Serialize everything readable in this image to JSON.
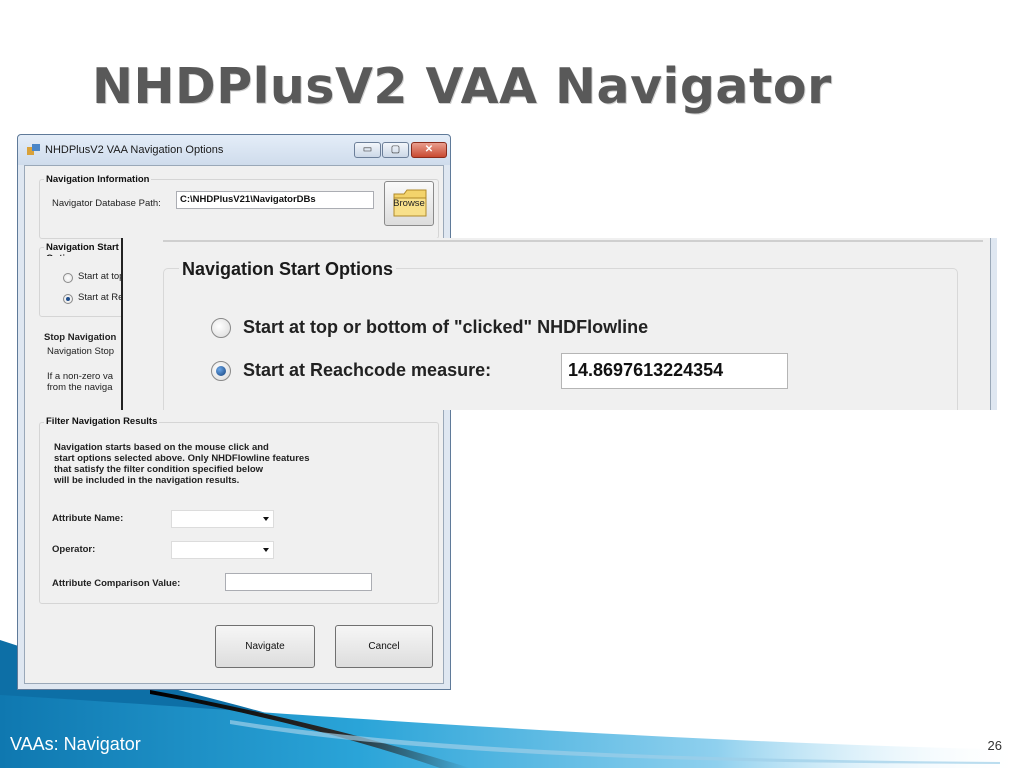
{
  "slide": {
    "title": "NHDPlusV2 VAA Navigator",
    "footer": "VAAs: Navigator",
    "page_number": "26"
  },
  "dialog": {
    "title": "NHDPlusV2 VAA Navigation Options",
    "controls": {
      "minimize": "▭",
      "maximize": "▢",
      "close": "✕"
    },
    "navigation_info": {
      "group_title": "Navigation Information",
      "db_path_label": "Navigator Database Path:",
      "db_path_value": "C:\\NHDPlusV21\\NavigatorDBs",
      "browse_label": "Browse"
    },
    "start_options": {
      "group_title": "Navigation Start Options",
      "option_top_bottom": "Start at top or bottom of \"clicked\" NHDFlowline",
      "option_reachcode": "Start at Reachcode measure:",
      "reachcode_value": "14.8697613224354"
    },
    "stop_navigation": {
      "group_title": "Stop Navigation",
      "line1": "Navigation Stop",
      "line2": "If a non-zero va",
      "line3": "from the naviga"
    },
    "filter": {
      "group_title": "Filter Navigation Results",
      "description": [
        "Navigation starts based on the mouse click and",
        "start options selected above.  Only NHDFlowline features",
        "that satisfy the filter condition specified below",
        "will be included in the navigation results."
      ],
      "attribute_name_label": "Attribute Name:",
      "operator_label": "Operator:",
      "comparison_label": "Attribute Comparison Value:"
    },
    "buttons": {
      "navigate": "Navigate",
      "cancel": "Cancel"
    }
  },
  "zoom": {
    "group_title": "Navigation Start Options",
    "option_top_bottom": "Start at top or bottom of \"clicked\" NHDFlowline",
    "option_reachcode": "Start at Reachcode measure:",
    "reachcode_value": "14.8697613224354"
  },
  "colors": {
    "title_text": "#595959",
    "swoosh_blue": "#1b8fc4",
    "swoosh_dark": "#1a1a1a",
    "window_frame": "#dfe7f1"
  },
  "icons": [
    "app-icon",
    "folder-icon",
    "minimize-icon",
    "maximize-icon",
    "close-icon",
    "combo-arrow-icon"
  ]
}
